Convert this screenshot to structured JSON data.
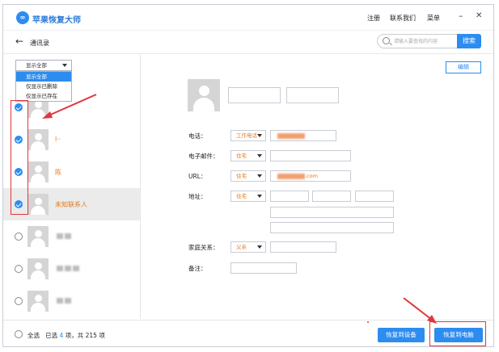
{
  "app": {
    "title": "苹果恢复大师",
    "logo_glyph": "∞"
  },
  "titlebar": {
    "register": "注册",
    "contact": "联系我们",
    "menu": "菜单",
    "minimize": "–",
    "close": "✕"
  },
  "nav": {
    "back_icon": "arrow-left-icon",
    "title": "通讯录"
  },
  "search": {
    "placeholder": "请输入要查找的内容",
    "button": "搜索"
  },
  "filter": {
    "selected": "显示全部",
    "options": [
      "显示全部",
      "仅显示已删除",
      "仅显示已存在"
    ]
  },
  "contacts": [
    {
      "name": "",
      "checked": true
    },
    {
      "name": "l··",
      "checked": true
    },
    {
      "name": "陈",
      "checked": true
    },
    {
      "name": "未知联系人",
      "checked": true,
      "active": true
    },
    {
      "name": "",
      "checked": false
    },
    {
      "name": "",
      "checked": false
    },
    {
      "name": "",
      "checked": false
    }
  ],
  "detail": {
    "edit_button": "编辑",
    "phone_label": "电话：",
    "phone_type": "工作电话",
    "phone_value": "",
    "email_label": "电子邮件：",
    "email_type": "住宅",
    "url_label": "URL：",
    "url_type": "住宅",
    "url_value": ".com",
    "address_label": "地址：",
    "address_type": "住宅",
    "family_label": "家庭关系：",
    "family_type": "父亲",
    "note_label": "备注："
  },
  "footer": {
    "select_all": "全选",
    "selected_prefix": "已选",
    "selected_count": "4",
    "selected_mid": "项，共",
    "total_count": "215",
    "selected_suffix": "项",
    "restore_device": "恢复到设备",
    "restore_pc": "恢复到电脑"
  },
  "colors": {
    "accent": "#2d8cf0",
    "orange": "#e07a1b",
    "highlight": "#e2363c"
  }
}
